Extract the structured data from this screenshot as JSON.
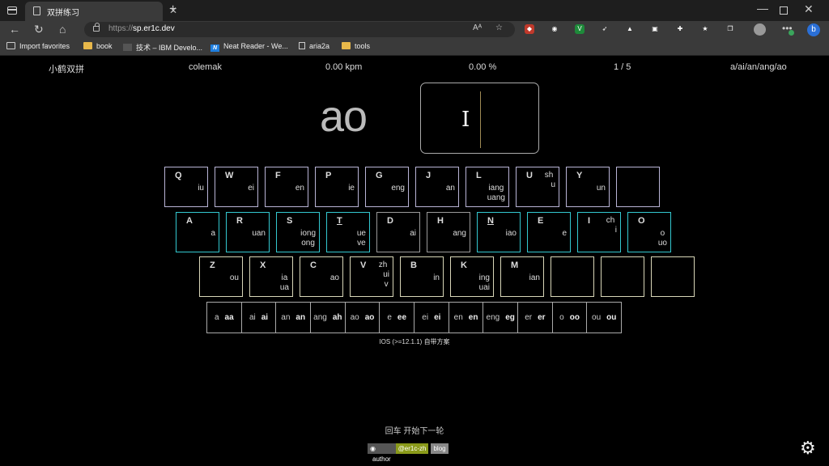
{
  "browser": {
    "tab_title": "双拼练习",
    "tab_close": "✕",
    "new_tab": "+",
    "url_protocol": "https://",
    "url_host": "sp.er1c.dev",
    "bookmarks": [
      "Import favorites",
      "book",
      "技术 – IBM Develo...",
      "Neat Reader - We...",
      "aria2a",
      "tools"
    ],
    "win_min": "—",
    "win_close": "✕",
    "addr_icons": [
      "Aᴬ",
      "☆"
    ],
    "extensions": [
      {
        "name": "ublock-icon",
        "color": "#c0392b",
        "glyph": "◆"
      },
      {
        "name": "eye-extension-icon",
        "color": "#3a3a3a",
        "glyph": "◉"
      },
      {
        "name": "v-extension-icon",
        "color": "#1e8a3a",
        "glyph": "V"
      },
      {
        "name": "arrow-extension-icon",
        "color": "#3a3a3a",
        "glyph": "➶"
      },
      {
        "name": "mountain-extension-icon",
        "color": "#3a3a3a",
        "glyph": "▲"
      },
      {
        "name": "game-extension-icon",
        "color": "#3a3a3a",
        "glyph": "▣"
      },
      {
        "name": "puzzle-extension-icon",
        "color": "#3a3a3a",
        "glyph": "✚"
      },
      {
        "name": "favorites-icon",
        "color": "#3a3a3a",
        "glyph": "★"
      },
      {
        "name": "collections-icon",
        "color": "#3a3a3a",
        "glyph": "❐"
      }
    ]
  },
  "stats": {
    "scheme": "小鹤双拼",
    "layout": "colemak",
    "speed": "0.00 kpm",
    "accuracy": "0.00 %",
    "progress": "1 / 5",
    "group": "a/ai/an/ang/ao"
  },
  "practice": {
    "current_word": "ao",
    "input_value": ""
  },
  "keyboard": {
    "rows": [
      [
        {
          "letter": "Q",
          "top": "",
          "vals": [
            "iu"
          ],
          "hl": false
        },
        {
          "letter": "W",
          "top": "",
          "vals": [
            "ei"
          ],
          "hl": false
        },
        {
          "letter": "F",
          "top": "",
          "vals": [
            "en"
          ],
          "hl": false
        },
        {
          "letter": "P",
          "top": "",
          "vals": [
            "ie"
          ],
          "hl": false
        },
        {
          "letter": "G",
          "top": "",
          "vals": [
            "eng"
          ],
          "hl": false
        },
        {
          "letter": "J",
          "top": "",
          "vals": [
            "an"
          ],
          "hl": false
        },
        {
          "letter": "L",
          "top": "",
          "vals": [
            "iang",
            "uang"
          ],
          "hl": false
        },
        {
          "letter": "U",
          "top": "sh",
          "vals": [
            "u"
          ],
          "hl": false
        },
        {
          "letter": "Y",
          "top": "",
          "vals": [
            "un"
          ],
          "hl": false
        },
        {
          "letter": "",
          "top": "",
          "vals": [],
          "hl": false
        }
      ],
      [
        {
          "letter": "A",
          "top": "",
          "vals": [
            "a"
          ],
          "hl": true
        },
        {
          "letter": "R",
          "top": "",
          "vals": [
            "uan"
          ],
          "hl": true
        },
        {
          "letter": "S",
          "top": "",
          "vals": [
            "iong",
            "ong"
          ],
          "hl": true
        },
        {
          "letter": "T",
          "top": "",
          "vals": [
            "ue",
            "ve"
          ],
          "hl": true,
          "ul": true
        },
        {
          "letter": "D",
          "top": "",
          "vals": [
            "ai"
          ],
          "hl": false
        },
        {
          "letter": "H",
          "top": "",
          "vals": [
            "ang"
          ],
          "hl": false
        },
        {
          "letter": "N",
          "top": "",
          "vals": [
            "iao"
          ],
          "hl": true,
          "ul": true
        },
        {
          "letter": "E",
          "top": "",
          "vals": [
            "e"
          ],
          "hl": true
        },
        {
          "letter": "I",
          "top": "ch",
          "vals": [
            "i"
          ],
          "hl": true
        },
        {
          "letter": "O",
          "top": "",
          "vals": [
            "o",
            "uo"
          ],
          "hl": true
        }
      ],
      [
        {
          "letter": "Z",
          "top": "",
          "vals": [
            "ou"
          ],
          "hl": false
        },
        {
          "letter": "X",
          "top": "",
          "vals": [
            "ia",
            "ua"
          ],
          "hl": false
        },
        {
          "letter": "C",
          "top": "",
          "vals": [
            "ao"
          ],
          "hl": false
        },
        {
          "letter": "V",
          "top": "zh",
          "vals": [
            "ui",
            "v"
          ],
          "hl": false
        },
        {
          "letter": "B",
          "top": "",
          "vals": [
            "in"
          ],
          "hl": false
        },
        {
          "letter": "K",
          "top": "",
          "vals": [
            "ing",
            "uai"
          ],
          "hl": false
        },
        {
          "letter": "M",
          "top": "",
          "vals": [
            "ian"
          ],
          "hl": false
        },
        {
          "letter": "",
          "top": "",
          "vals": [],
          "hl": false
        },
        {
          "letter": "",
          "top": "",
          "vals": [],
          "hl": false
        },
        {
          "letter": "",
          "top": "",
          "vals": [],
          "hl": false
        }
      ]
    ],
    "colors": {
      "normal": "#9a9a9a",
      "row1": "#b9b4d6",
      "row3": "#d8d6b8",
      "highlight": "#33c8d0"
    }
  },
  "zero_initials": [
    {
      "syllable": "a",
      "code": "aa"
    },
    {
      "syllable": "ai",
      "code": "ai"
    },
    {
      "syllable": "an",
      "code": "an"
    },
    {
      "syllable": "ang",
      "code": "ah"
    },
    {
      "syllable": "ao",
      "code": "ao"
    },
    {
      "syllable": "e",
      "code": "ee"
    },
    {
      "syllable": "ei",
      "code": "ei"
    },
    {
      "syllable": "en",
      "code": "en"
    },
    {
      "syllable": "eng",
      "code": "eg"
    },
    {
      "syllable": "er",
      "code": "er"
    },
    {
      "syllable": "o",
      "code": "oo"
    },
    {
      "syllable": "ou",
      "code": "ou"
    }
  ],
  "note": "IOS (>=12.1.1) 自带方案",
  "restart_hint": "回车 开始下一轮",
  "footer": {
    "author_label": "author",
    "handle": "@er1c-zh",
    "blog": "blog"
  }
}
